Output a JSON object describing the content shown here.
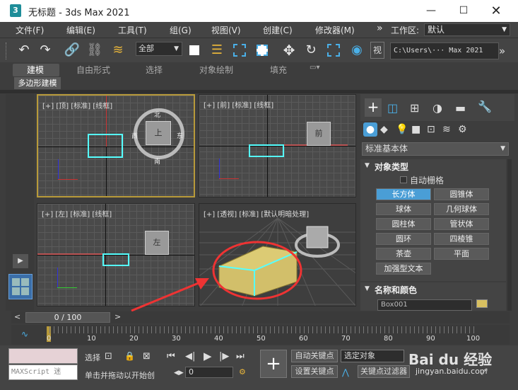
{
  "window": {
    "title": "无标题 - 3ds Max 2021",
    "app_icon": "3"
  },
  "menu": {
    "items": [
      "文件(F)",
      "编辑(E)",
      "工具(T)",
      "组(G)",
      "视图(V)",
      "创建(C)",
      "修改器(M)"
    ],
    "overflow": "»",
    "workspace_label": "工作区:",
    "workspace_value": "默认"
  },
  "toolbar": {
    "selection_filter": "全部",
    "view_label": "视",
    "path": "C:\\Users\\··· Max 2021"
  },
  "ribbon": {
    "tabs": [
      "建模",
      "自由形式",
      "选择",
      "对象绘制",
      "填充"
    ],
    "active_tab": "建模",
    "sub_label": "多边形建模"
  },
  "viewports": {
    "top": {
      "label": "[+] [顶] [标准] [线框]"
    },
    "front": {
      "label": "[+] [前] [标准] [线框]"
    },
    "left": {
      "label": "[+] [左] [标准] [线框]"
    },
    "persp": {
      "label": "[+] [透视] [标准] [默认明暗处理]"
    }
  },
  "viewcube": {
    "top": "上",
    "front": "前",
    "left": "左",
    "north": "北",
    "south": "南",
    "east": "东",
    "west": "西"
  },
  "command_panel": {
    "category": "标准基本体",
    "object_type_header": "对象类型",
    "autogrid": "自动栅格",
    "buttons": [
      "长方体",
      "圆锥体",
      "球体",
      "几何球体",
      "圆柱体",
      "管状体",
      "圆环",
      "四棱锥",
      "茶壶",
      "平面",
      "加强型文本"
    ],
    "active_button": "长方体",
    "name_color_header": "名称和颜色",
    "object_name": "Box001",
    "object_color": "#d8c060"
  },
  "timeline": {
    "position": "0 / 100",
    "ticks": [
      "0",
      "10",
      "20",
      "30",
      "40",
      "50",
      "60",
      "70",
      "80",
      "90",
      "100"
    ],
    "current_frame": "0"
  },
  "status": {
    "maxscript": "MAXScript 迷",
    "selection_label": "选择",
    "hint": "单击并拖动以开始创",
    "auto_key": "自动关键点",
    "set_key": "设置关键点",
    "selected_object": "选定对象",
    "key_filter": "关键点过滤器",
    "watermark": "Bai du 经验",
    "watermark_url": "jingyan.baidu.com"
  }
}
